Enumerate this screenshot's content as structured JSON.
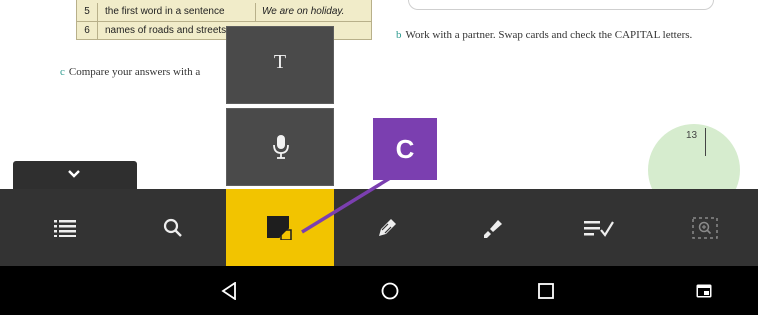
{
  "textbook": {
    "table_rows": [
      {
        "num": "5",
        "desc": "the first word in a sentence",
        "example": "We are on holiday."
      },
      {
        "num": "6",
        "desc": "names of roads and streets",
        "example": ""
      }
    ],
    "instruction_b": {
      "letter": "b",
      "text": "Work with a partner. Swap cards and check the CAPITAL letters."
    },
    "instruction_c": {
      "letter": "c",
      "text": "Compare your answers with a"
    },
    "page_number": "13"
  },
  "popup": {
    "text_tool_glyph": "T"
  },
  "toolbar": {
    "items": [
      "list-icon",
      "search-icon",
      "sticky-note-icon",
      "pencil-icon",
      "highlighter-icon",
      "checklist-icon",
      "zoom-select-icon"
    ],
    "active_item": "sticky-note-icon",
    "active_color": "#f2c400",
    "background_color": "#333333"
  },
  "navbar": {
    "items": [
      "back-icon",
      "home-icon",
      "recents-icon",
      "screen-icon"
    ]
  },
  "annotation": {
    "label": "C",
    "color": "#7b3fb0"
  }
}
